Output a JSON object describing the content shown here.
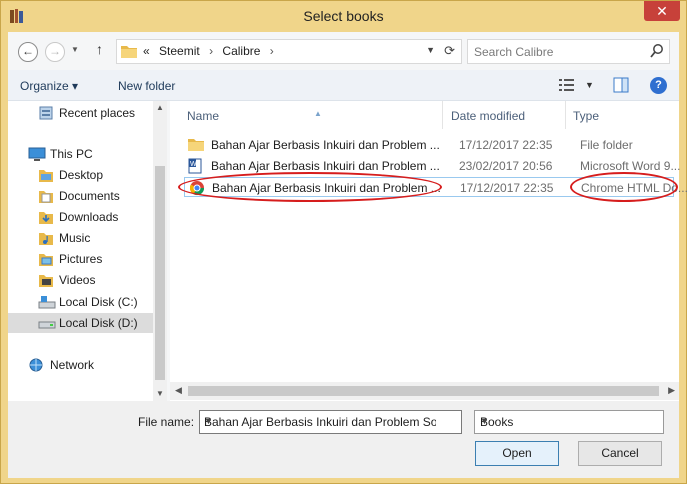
{
  "window": {
    "title": "Select books",
    "close_label": "✕"
  },
  "address_bar": {
    "prefix": "«",
    "crumbs": [
      "Steemit",
      "Calibre"
    ],
    "separator": "›"
  },
  "search": {
    "placeholder": "Search Calibre"
  },
  "toolbar": {
    "organize_label": "Organize ▾",
    "new_folder_label": "New folder",
    "help_label": "?"
  },
  "nav_pane": {
    "items": [
      {
        "label": "Recent places",
        "icon": "recent-places-icon"
      },
      {
        "label": "This PC",
        "icon": "computer-icon"
      },
      {
        "label": "Desktop",
        "icon": "folder-icon"
      },
      {
        "label": "Documents",
        "icon": "folder-icon"
      },
      {
        "label": "Downloads",
        "icon": "folder-icon"
      },
      {
        "label": "Music",
        "icon": "folder-icon"
      },
      {
        "label": "Pictures",
        "icon": "folder-icon"
      },
      {
        "label": "Videos",
        "icon": "folder-icon"
      },
      {
        "label": "Local Disk (C:)",
        "icon": "drive-icon"
      },
      {
        "label": "Local Disk (D:)",
        "icon": "drive-icon",
        "selected": true
      },
      {
        "label": "Network",
        "icon": "network-icon"
      }
    ]
  },
  "file_list": {
    "columns": {
      "name": "Name",
      "date_modified": "Date modified",
      "type": "Type"
    },
    "rows": [
      {
        "name": "Bahan Ajar Berbasis Inkuiri dan Problem ...",
        "date": "17/12/2017 22:35",
        "type": "File folder",
        "icon": "folder-icon"
      },
      {
        "name": "Bahan Ajar Berbasis Inkuiri dan Problem ...",
        "date": "23/02/2017 20:56",
        "type": "Microsoft Word 9...",
        "icon": "word-document-icon"
      },
      {
        "name": "Bahan Ajar Berbasis Inkuiri dan Problem ...",
        "date": "17/12/2017 22:35",
        "type": "Chrome HTML Do...",
        "icon": "chrome-html-icon",
        "selected": true
      }
    ]
  },
  "bottom": {
    "file_name_label": "File name:",
    "file_name_value": "Bahan Ajar Berbasis Inkuiri dan Problem Solvi",
    "filter_value": "Books",
    "open_label": "Open",
    "cancel_label": "Cancel"
  },
  "colors": {
    "frame": "#f0d58a",
    "close_button": "#c7413a",
    "annotation_oval": "#d61d1d",
    "selection_border": "#99c9ef"
  }
}
